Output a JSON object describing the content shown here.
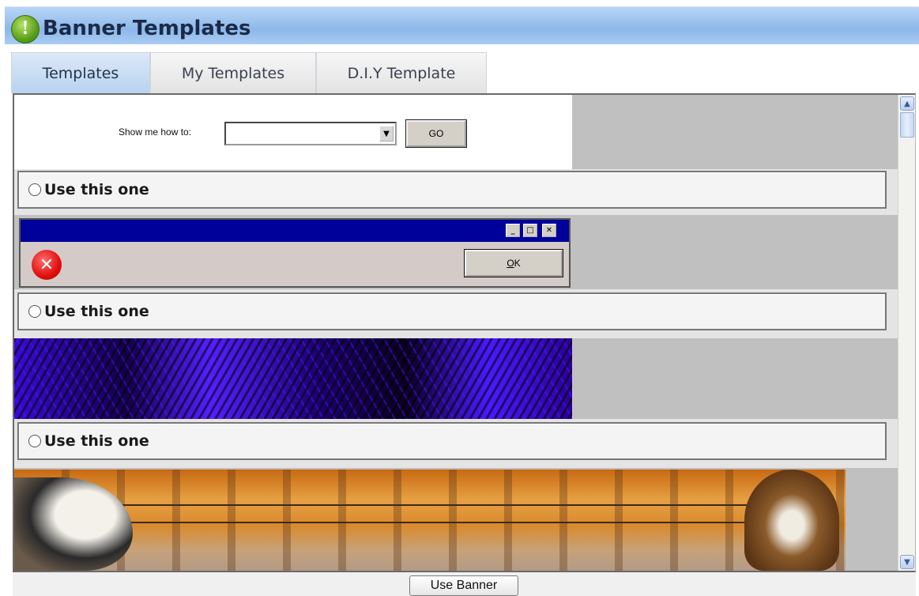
{
  "header": {
    "title": "Banner Templates",
    "icon": "info-icon"
  },
  "tabs": [
    {
      "label": "Templates",
      "active": true
    },
    {
      "label": "My Templates",
      "active": false
    },
    {
      "label": "D.I.Y Template",
      "active": false
    }
  ],
  "howto": {
    "label": "Show me how to:",
    "selected": "",
    "go_label": "GO"
  },
  "templates": [
    {
      "use_label": "Use this one",
      "selected": false
    },
    {
      "use_label": "Use this one",
      "selected": false
    },
    {
      "use_label": "Use this one",
      "selected": false
    }
  ],
  "dialog": {
    "ok_label": "K",
    "ok_mnemonic": "O"
  },
  "footer": {
    "use_banner_label": "Use Banner"
  },
  "colors": {
    "header_blue": "#8db8ea",
    "dialog_title": "#00009a",
    "purple": "#5520ff"
  }
}
